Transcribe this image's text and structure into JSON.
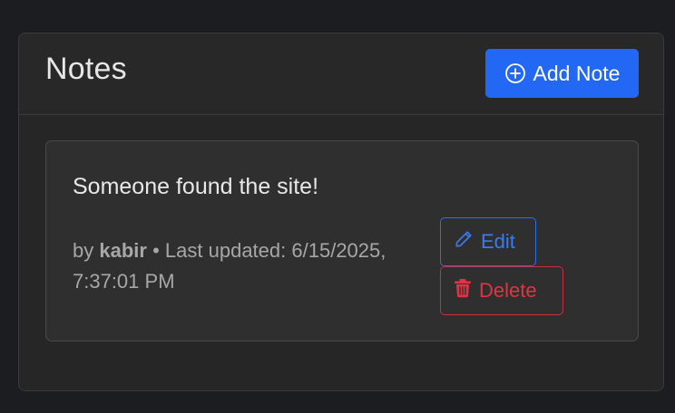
{
  "notes_panel": {
    "title": "Notes",
    "add_button": {
      "label": "Add Note",
      "icon": "plus-circle-icon",
      "color": "#2368f5"
    }
  },
  "notes": [
    {
      "text": "Someone found the site!",
      "by_prefix": "by",
      "author": "kabir",
      "separator": "•",
      "updated_prefix": "Last updated:",
      "updated_date": "6/15/2025,",
      "updated_time": "7:37:01 PM",
      "edit_label": "Edit",
      "edit_icon": "pencil-icon",
      "delete_label": "Delete",
      "delete_icon": "trash-icon"
    }
  ],
  "colors": {
    "edit": "#3b7af4",
    "delete": "#dc3545",
    "background": "#1c1d20",
    "panel": "#262626",
    "card": "#2f2f2f"
  }
}
